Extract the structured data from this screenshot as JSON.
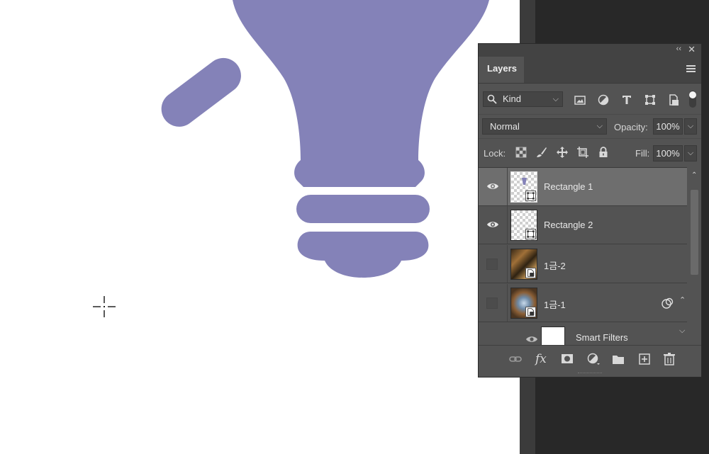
{
  "colors": {
    "bulb": "#8482b8",
    "panel_bg": "#535353",
    "selected_row": "#6e6e6e",
    "dark_workspace": "#282828"
  },
  "panel": {
    "collapse_glyph": "‹‹",
    "close_glyph": "✕",
    "tab_label": "Layers",
    "menu_icon": "hamburger-menu-icon"
  },
  "filter": {
    "kind_label": "Kind",
    "chevron": "⌵",
    "icons": [
      "image-filter-icon",
      "adjustment-filter-icon",
      "type-filter-icon",
      "shape-filter-icon",
      "smart-object-filter-icon"
    ]
  },
  "blend": {
    "mode": "Normal",
    "opacity_label": "Opacity:",
    "opacity_value": "100%"
  },
  "lock": {
    "label": "Lock:",
    "icons": [
      "lock-transparent-pixels-icon",
      "lock-image-pixels-icon",
      "lock-position-icon",
      "lock-artboard-icon",
      "lock-all-icon"
    ],
    "fill_label": "Fill:",
    "fill_value": "100%"
  },
  "layers": [
    {
      "name": "Rectangle 1",
      "visible": true,
      "selected": true
    },
    {
      "name": "Rectangle 2",
      "visible": true,
      "selected": false
    },
    {
      "name": "1금-2",
      "visible": false,
      "selected": false
    },
    {
      "name": "1금-1",
      "visible": false,
      "selected": false
    }
  ],
  "smart_filters": {
    "label": "Smart Filters"
  },
  "bottom_icons": [
    "link-layers-icon",
    "fx-icon",
    "add-mask-icon",
    "adjustment-layer-icon",
    "new-group-icon",
    "new-layer-icon",
    "delete-layer-icon"
  ],
  "fx_label": "fx"
}
